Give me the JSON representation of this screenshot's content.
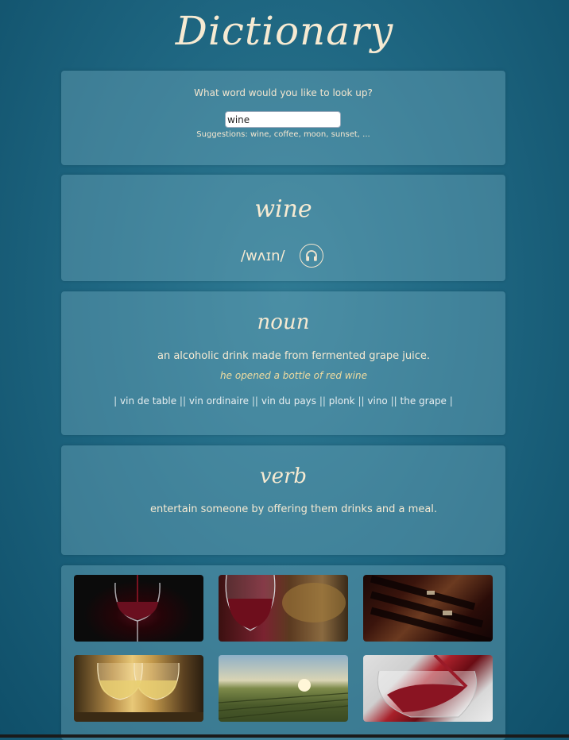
{
  "app": {
    "title": "Dictionary"
  },
  "search": {
    "prompt": "What word would you like to look up?",
    "value": "wine",
    "suggestions_label": "Suggestions:",
    "suggestions": [
      "wine",
      "coffee",
      "moon",
      "sunset",
      "..."
    ]
  },
  "entry": {
    "word": "wine",
    "pronunciation": "/wʌɪn/",
    "audio_icon": "headphones-icon"
  },
  "noun": {
    "pos": "noun",
    "definition": "an alcoholic drink made from fermented grape juice.",
    "example": "he opened a bottle of red wine",
    "synonyms": [
      "vin de table",
      "vin ordinaire",
      "vin du pays",
      "plonk",
      "vino",
      "the grape"
    ]
  },
  "verb": {
    "pos": "verb",
    "definition": "entertain someone by offering them drinks and a meal."
  },
  "images": [
    "red wine pouring into glass",
    "glass of red wine with food",
    "wine bottles in rack",
    "two glasses of white wine",
    "vineyard at sunset",
    "red wine splash in glass"
  ],
  "colors": {
    "text": "#f3e6cf",
    "panel": "#4d8fa6",
    "background": "#1f6782"
  }
}
